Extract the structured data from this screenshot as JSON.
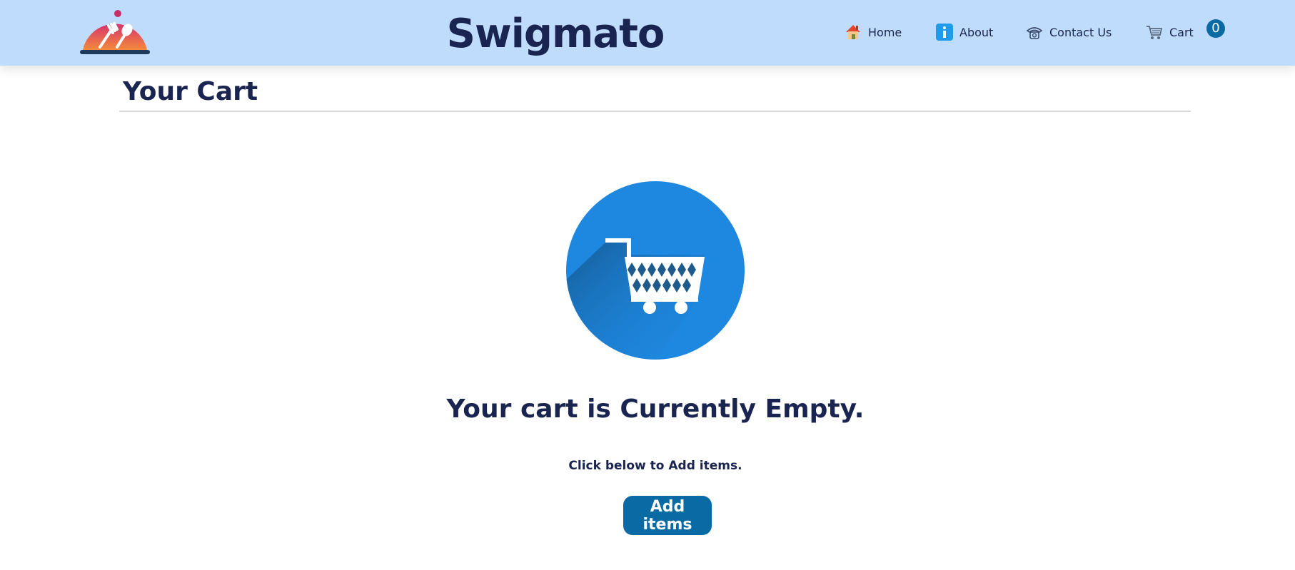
{
  "header": {
    "brand": "Swigmato",
    "logo_icon": "food-cloche-logo-icon",
    "nav": {
      "home": {
        "label": "Home",
        "icon": "house-icon"
      },
      "about": {
        "label": "About",
        "icon": "info-icon"
      },
      "contact": {
        "label": "Contact Us",
        "icon": "telephone-icon"
      },
      "cart": {
        "label": "Cart",
        "icon": "shopping-cart-icon",
        "count": "0"
      }
    }
  },
  "main": {
    "title": "Your Cart",
    "empty_icon": "empty-cart-icon",
    "empty_heading": "Your cart is Currently Empty.",
    "hint": "Click below to Add items.",
    "add_button_label": "Add items"
  },
  "colors": {
    "header_bg": "#bfdcfd",
    "text": "#1a2450",
    "accent": "#0a6aa3",
    "illustration_blue": "#1e88e0"
  }
}
